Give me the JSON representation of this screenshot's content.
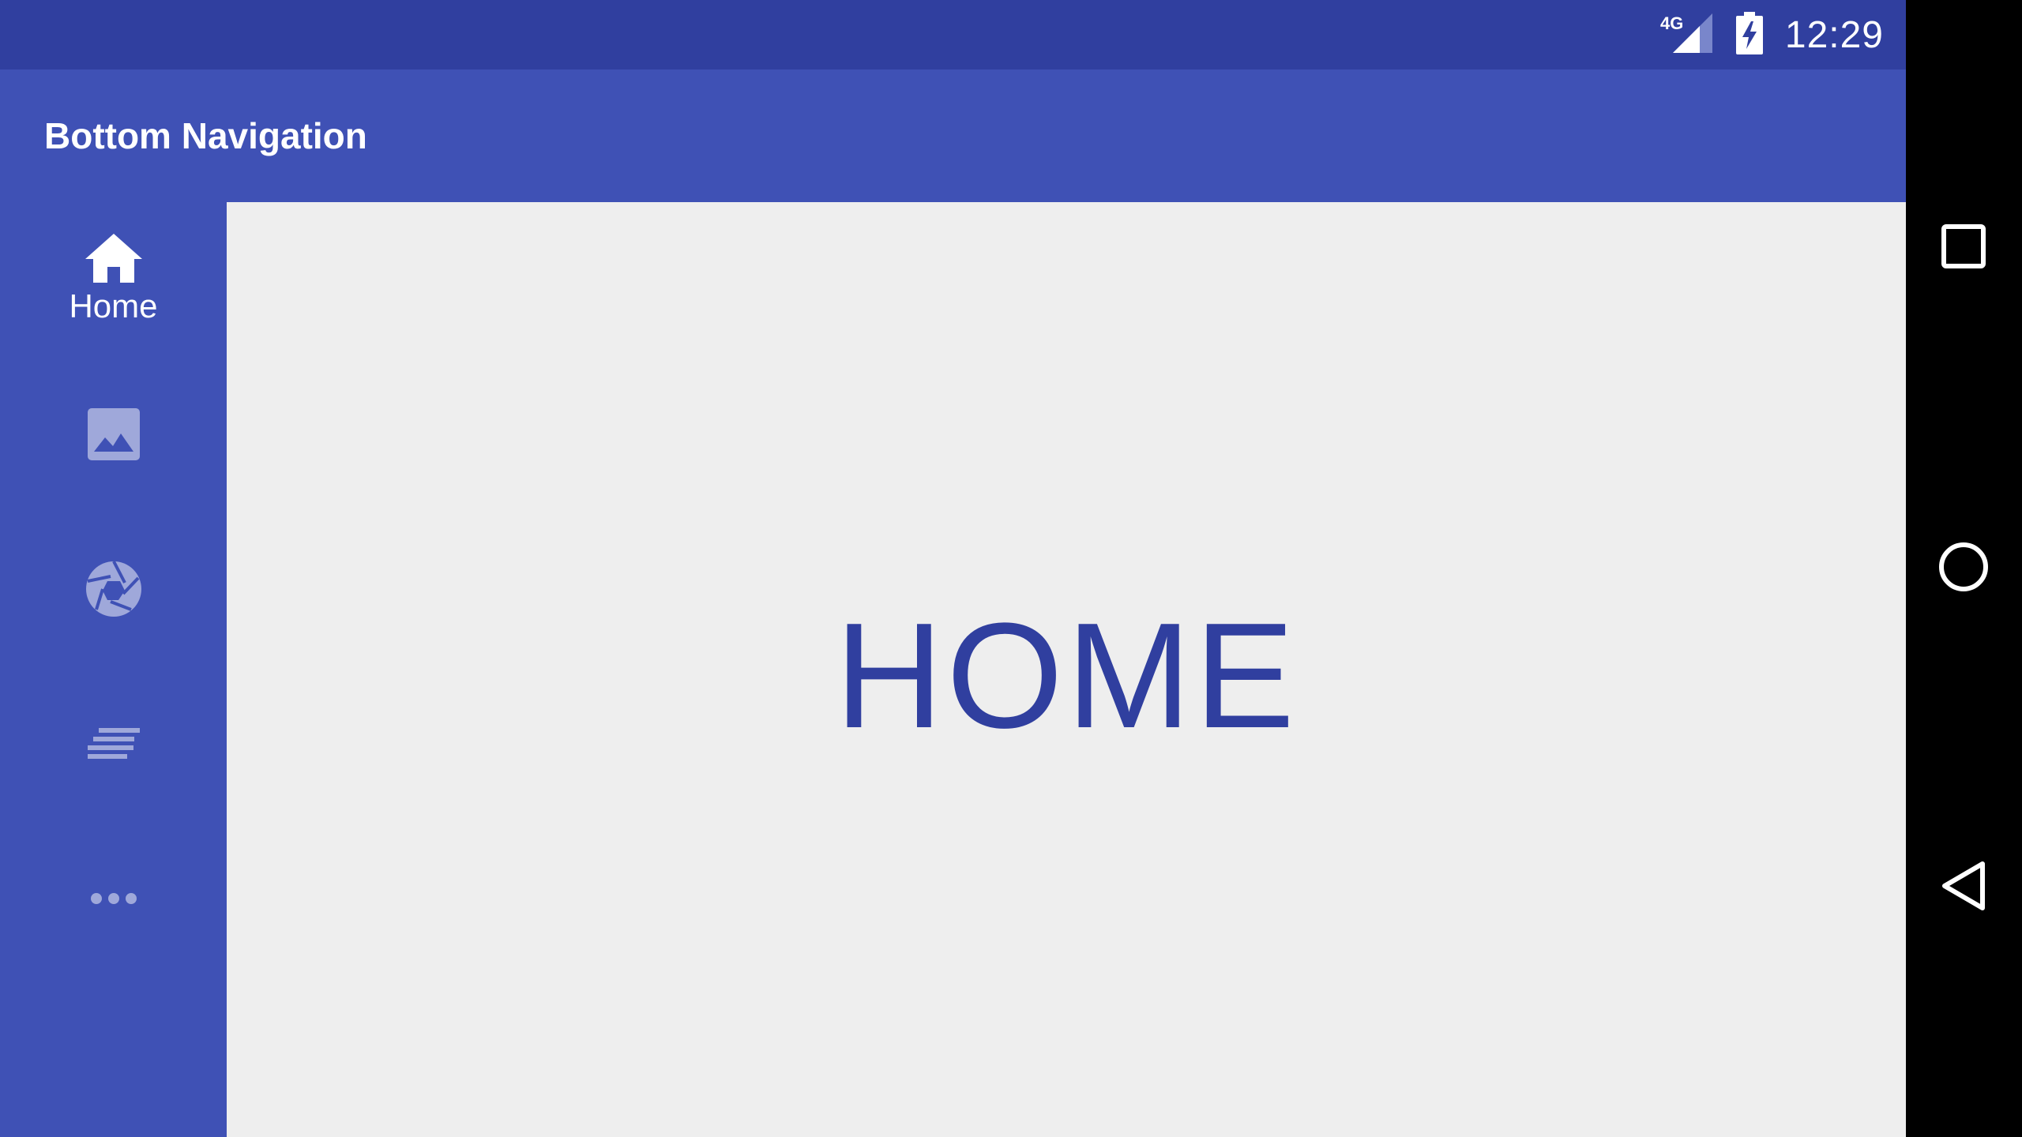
{
  "status_bar": {
    "network": "4G",
    "time": "12:29",
    "icons": [
      "signal-icon",
      "battery-charging-icon"
    ]
  },
  "app_bar": {
    "title": "Bottom Navigation"
  },
  "side_nav": {
    "items": [
      {
        "icon": "home-icon",
        "label": "Home",
        "active": true
      },
      {
        "icon": "image-icon",
        "label": "",
        "active": false
      },
      {
        "icon": "camera-aperture-icon",
        "label": "",
        "active": false
      },
      {
        "icon": "notes-icon",
        "label": "",
        "active": false
      },
      {
        "icon": "more-horiz-icon",
        "label": "",
        "active": false
      }
    ]
  },
  "content": {
    "text": "HOME"
  },
  "system_nav": {
    "buttons": [
      "recents-icon",
      "home-circle-icon",
      "back-icon"
    ]
  },
  "colors": {
    "status_bar": "#303F9F",
    "primary": "#3F51B5",
    "background": "#EEEEEE",
    "content_text": "#303F9F",
    "inactive_icon": "#9FA8DA",
    "active_icon": "#FFFFFF"
  }
}
